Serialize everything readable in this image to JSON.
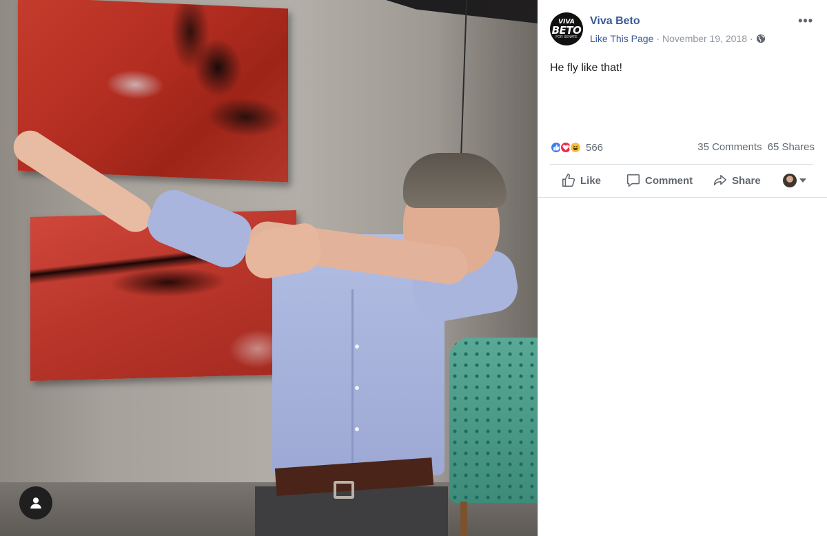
{
  "post": {
    "page_name": "Viva Beto",
    "logo_text": {
      "line1": "VIVA",
      "line2": "BETO",
      "line3": "FOR SENATE"
    },
    "like_page_label": "Like This Page",
    "date": "November 19, 2018",
    "separator": "·",
    "text": "He fly like that!",
    "reaction_count": "566",
    "comments": "35 Comments",
    "shares": "65 Shares"
  },
  "actions": {
    "like": "Like",
    "comment": "Comment",
    "share": "Share"
  },
  "icons": {
    "more": "more-options-icon",
    "globe": "globe-icon",
    "like_reaction": "like-reaction-icon",
    "love_reaction": "love-reaction-icon",
    "haha_reaction": "haha-reaction-icon",
    "profile_fab": "person-icon"
  },
  "colors": {
    "link": "#385898",
    "meta": "#8d949e",
    "action": "#606770",
    "like": "#3d7df2",
    "love": "#f0284a",
    "haha": "#f7c33e"
  }
}
